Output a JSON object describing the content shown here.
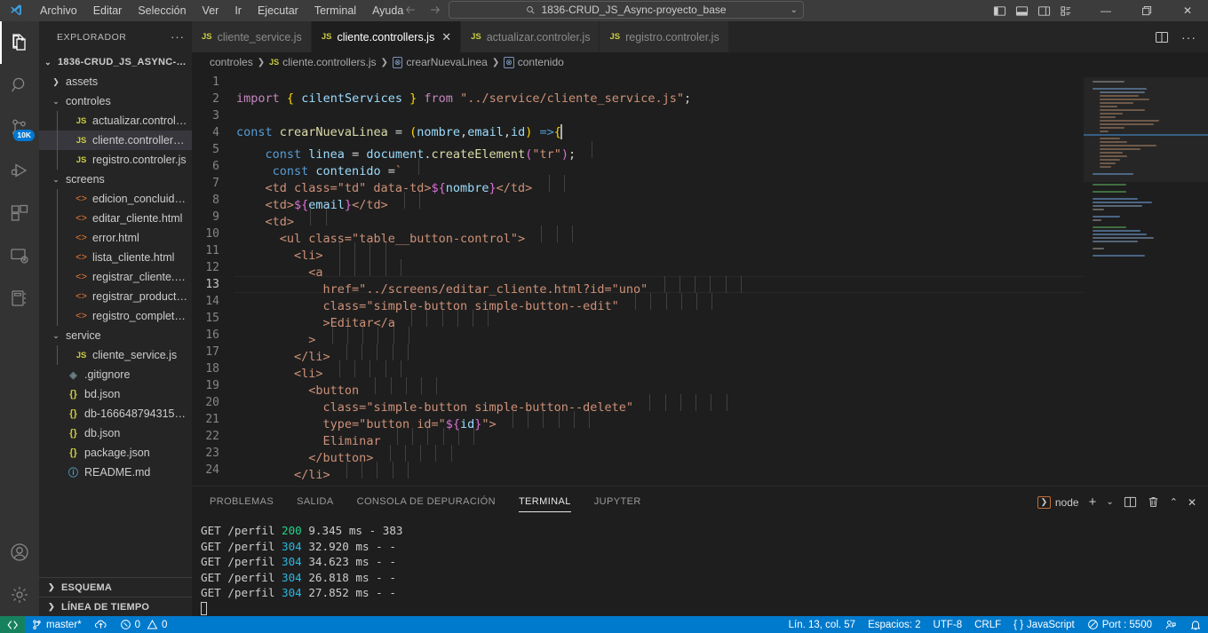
{
  "titlebar": {
    "menu": [
      "Archivo",
      "Editar",
      "Selección",
      "Ver",
      "Ir",
      "Ejecutar",
      "Terminal",
      "Ayuda"
    ],
    "search_text": "1836-CRUD_JS_Async-proyecto_base",
    "back_icon": "arrow-left-icon",
    "forward_icon": "arrow-right-icon",
    "minimize_label": "—",
    "maximize_label": "❐",
    "close_label": "✕"
  },
  "activitybar": {
    "items": [
      {
        "name": "explorer",
        "icon": "files-icon",
        "active": true,
        "badge": ""
      },
      {
        "name": "search",
        "icon": "search-icon",
        "active": false,
        "badge": ""
      },
      {
        "name": "source-control",
        "icon": "source-control-icon",
        "active": false,
        "badge": "10K"
      },
      {
        "name": "run-debug",
        "icon": "run-debug-icon",
        "active": false,
        "badge": ""
      },
      {
        "name": "extensions",
        "icon": "extensions-icon",
        "active": false,
        "badge": ""
      },
      {
        "name": "remote-explorer",
        "icon": "remote-explorer-icon",
        "active": false,
        "badge": ""
      },
      {
        "name": "notebook",
        "icon": "notebook-icon",
        "active": false,
        "badge": ""
      }
    ],
    "bottom": [
      {
        "name": "accounts",
        "icon": "account-icon"
      },
      {
        "name": "settings",
        "icon": "gear-icon"
      }
    ]
  },
  "sidebar": {
    "title": "EXPLORADOR",
    "more_label": "···",
    "tree": [
      {
        "label": "1836-CRUD_JS_ASYNC-PR...",
        "type": "root",
        "indent": 0,
        "twisty": "down"
      },
      {
        "label": "assets",
        "type": "folder",
        "indent": 1,
        "twisty": "right"
      },
      {
        "label": "controles",
        "type": "folder",
        "indent": 1,
        "twisty": "down"
      },
      {
        "label": "actualizar.controler.js",
        "type": "js",
        "indent": 2,
        "twisty": ""
      },
      {
        "label": "cliente.controllers.js",
        "type": "js",
        "indent": 2,
        "twisty": "",
        "selected": true
      },
      {
        "label": "registro.controler.js",
        "type": "js",
        "indent": 2,
        "twisty": ""
      },
      {
        "label": "screens",
        "type": "folder",
        "indent": 1,
        "twisty": "down"
      },
      {
        "label": "edicion_concluida.ht...",
        "type": "html",
        "indent": 2,
        "twisty": ""
      },
      {
        "label": "editar_cliente.html",
        "type": "html",
        "indent": 2,
        "twisty": ""
      },
      {
        "label": "error.html",
        "type": "html",
        "indent": 2,
        "twisty": ""
      },
      {
        "label": "lista_cliente.html",
        "type": "html",
        "indent": 2,
        "twisty": ""
      },
      {
        "label": "registrar_cliente.html",
        "type": "html",
        "indent": 2,
        "twisty": ""
      },
      {
        "label": "registrar_producto.h...",
        "type": "html",
        "indent": 2,
        "twisty": ""
      },
      {
        "label": "registro_completado...",
        "type": "html",
        "indent": 2,
        "twisty": ""
      },
      {
        "label": "service",
        "type": "folder",
        "indent": 1,
        "twisty": "down"
      },
      {
        "label": "cliente_service.js",
        "type": "js",
        "indent": 2,
        "twisty": ""
      },
      {
        "label": ".gitignore",
        "type": "git",
        "indent": 1,
        "twisty": ""
      },
      {
        "label": "bd.json",
        "type": "json",
        "indent": 1,
        "twisty": ""
      },
      {
        "label": "db-1666487943150.js...",
        "type": "json",
        "indent": 1,
        "twisty": ""
      },
      {
        "label": "db.json",
        "type": "json",
        "indent": 1,
        "twisty": ""
      },
      {
        "label": "package.json",
        "type": "json",
        "indent": 1,
        "twisty": ""
      },
      {
        "label": "README.md",
        "type": "md",
        "indent": 1,
        "twisty": ""
      }
    ],
    "sections": [
      {
        "label": "ESQUEMA",
        "twisty": "right"
      },
      {
        "label": "LÍNEA DE TIEMPO",
        "twisty": "right"
      }
    ]
  },
  "tabs": [
    {
      "label": "cliente_service.js",
      "icon": "js-file-icon",
      "active": false,
      "closable": false
    },
    {
      "label": "cliente.controllers.js",
      "icon": "js-file-icon",
      "active": true,
      "closable": true,
      "close_label": "✕"
    },
    {
      "label": "actualizar.controler.js",
      "icon": "js-file-icon",
      "active": false,
      "closable": false
    },
    {
      "label": "registro.controler.js",
      "icon": "js-file-icon",
      "active": false,
      "closable": false
    }
  ],
  "editor_actions": [
    {
      "name": "split-editor",
      "icon": "split-editor-icon"
    },
    {
      "name": "more-actions",
      "icon": "ellipsis-icon",
      "label": "···"
    }
  ],
  "breadcrumb": [
    {
      "label": "controles",
      "icon": ""
    },
    {
      "label": "cliente.controllers.js",
      "icon": "js"
    },
    {
      "label": "crearNuevaLinea",
      "icon": "symbol"
    },
    {
      "label": "contenido",
      "icon": "symbol"
    }
  ],
  "code": {
    "first_line": 1,
    "current_line": 13,
    "lines": [
      {
        "n": 1,
        "html": ""
      },
      {
        "n": 2,
        "html": "<span class='tok-kw'>import</span> <span class='tok-brace'>{</span> <span class='tok-var'>cilentServices</span> <span class='tok-brace'>}</span> <span class='tok-kw'>from</span> <span class='tok-str'>\"../service/cliente_service.js\"</span><span class='tok-plain'>;</span>"
      },
      {
        "n": 3,
        "html": ""
      },
      {
        "n": 4,
        "html": "<span class='tok-kw2'>const</span> <span class='tok-fn'>crearNuevaLinea</span> <span class='tok-plain'>=</span> <span class='tok-brace'>(</span><span class='tok-var'>nombre</span><span class='tok-plain'>,</span><span class='tok-var'>email</span><span class='tok-plain'>,</span><span class='tok-var'>id</span><span class='tok-brace'>)</span> <span class='tok-kw2'>=&gt;</span><span class='tok-brace'>{</span>"
      },
      {
        "n": 5,
        "html": "    <span class='tok-kw2'>const</span> <span class='tok-var'>linea</span> <span class='tok-plain'>=</span> <span class='tok-var'>document</span><span class='tok-plain'>.</span><span class='tok-fn'>createElement</span><span class='tok-brace2'>(</span><span class='tok-str'>\"tr\"</span><span class='tok-brace2'>)</span><span class='tok-plain'>;</span>"
      },
      {
        "n": 6,
        "html": "     <span class='tok-kw2'>const</span> <span class='tok-var'>contenido</span> <span class='tok-plain'>=</span><span class='tok-str'>`</span>"
      },
      {
        "n": 7,
        "html": "    <span class='tok-str'>&lt;td class=\"td\" data-td&gt;</span><span class='tok-brace2'>${</span><span class='tok-var'>nombre</span><span class='tok-brace2'>}</span><span class='tok-str'>&lt;/td&gt;</span>"
      },
      {
        "n": 8,
        "html": "    <span class='tok-str'>&lt;td&gt;</span><span class='tok-brace2'>${</span><span class='tok-var'>email</span><span class='tok-brace2'>}</span><span class='tok-str'>&lt;/td&gt;</span>"
      },
      {
        "n": 9,
        "html": "    <span class='tok-str'>&lt;td&gt;</span>"
      },
      {
        "n": 10,
        "html": "      <span class='tok-str'>&lt;ul class=\"table__button-control\"&gt;</span>"
      },
      {
        "n": 11,
        "html": "        <span class='tok-str'>&lt;li&gt;</span>"
      },
      {
        "n": 12,
        "html": "          <span class='tok-str'>&lt;a</span>"
      },
      {
        "n": 13,
        "html": "            <span class='tok-str'>href=\"../screens/editar_cliente.html?id=\"uno\"</span>",
        "highlight": true
      },
      {
        "n": 14,
        "html": "            <span class='tok-str'>class=\"simple-button simple-button--edit\"</span>"
      },
      {
        "n": 15,
        "html": "            <span class='tok-str'>&gt;Editar&lt;/a</span>"
      },
      {
        "n": 16,
        "html": "          <span class='tok-str'>&gt;</span>"
      },
      {
        "n": 17,
        "html": "        <span class='tok-str'>&lt;/li&gt;</span>"
      },
      {
        "n": 18,
        "html": "        <span class='tok-str'>&lt;li&gt;</span>"
      },
      {
        "n": 19,
        "html": "          <span class='tok-str'>&lt;button</span>"
      },
      {
        "n": 20,
        "html": "            <span class='tok-str'>class=\"simple-button simple-button--delete\"</span>"
      },
      {
        "n": 21,
        "html": "            <span class='tok-str'>type=\"button id=\"</span><span class='tok-brace2'>${</span><span class='tok-var'>id</span><span class='tok-brace2'>}</span><span class='tok-str'>\"&gt;</span>"
      },
      {
        "n": 22,
        "html": "            <span class='tok-str'>Eliminar</span>"
      },
      {
        "n": 23,
        "html": "          <span class='tok-str'>&lt;/button&gt;</span>"
      },
      {
        "n": 24,
        "html": "        <span class='tok-str'>&lt;/li&gt;</span>"
      }
    ]
  },
  "panel": {
    "tabs": [
      {
        "label": "PROBLEMAS",
        "active": false
      },
      {
        "label": "SALIDA",
        "active": false
      },
      {
        "label": "CONSOLA DE DEPURACIÓN",
        "active": false
      },
      {
        "label": "TERMINAL",
        "active": true
      },
      {
        "label": "JUPYTER",
        "active": false
      }
    ],
    "terminal_name": "node",
    "actions": [
      {
        "name": "new-terminal",
        "icon": "plus-icon",
        "label": "+"
      },
      {
        "name": "terminal-dropdown",
        "icon": "chevron-down-icon",
        "label": "⌄"
      },
      {
        "name": "split-terminal",
        "icon": "split-icon"
      },
      {
        "name": "kill-terminal",
        "icon": "trash-icon"
      },
      {
        "name": "maximize-panel",
        "icon": "chevron-up-icon",
        "label": "⌃"
      },
      {
        "name": "close-panel",
        "icon": "close-icon",
        "label": "✕"
      }
    ],
    "terminal_lines": [
      {
        "method": "GET /perfil ",
        "status": "200",
        "rest": " 9.345 ms - 383"
      },
      {
        "method": "GET /perfil ",
        "status": "304",
        "rest": " 32.920 ms - -"
      },
      {
        "method": "GET /perfil ",
        "status": "304",
        "rest": " 34.623 ms - -"
      },
      {
        "method": "GET /perfil ",
        "status": "304",
        "rest": " 26.818 ms - -"
      },
      {
        "method": "GET /perfil ",
        "status": "304",
        "rest": " 27.852 ms - -"
      }
    ]
  },
  "statusbar": {
    "remote_icon": "remote-window-icon",
    "branch": "master*",
    "sync_icon": "sync-cloud-icon",
    "errors": "0",
    "warnings": "0",
    "cursor": "Lín. 13, col. 57",
    "spaces": "Espacios: 2",
    "encoding": "UTF-8",
    "eol": "CRLF",
    "language": "JavaScript",
    "port": "Port : 5500",
    "feedback_icon": "feedback-icon",
    "bell_icon": "bell-icon"
  },
  "colors": {
    "accent": "#007acc",
    "remote_green": "#16825d",
    "titlebar": "#3c3c3c",
    "sidebar": "#252526",
    "editor": "#1e1e1e",
    "activitybar": "#333333",
    "js_yellow": "#cbcb41",
    "html_orange": "#e37933",
    "status_200": "#23d18b",
    "status_304": "#29b8db"
  }
}
